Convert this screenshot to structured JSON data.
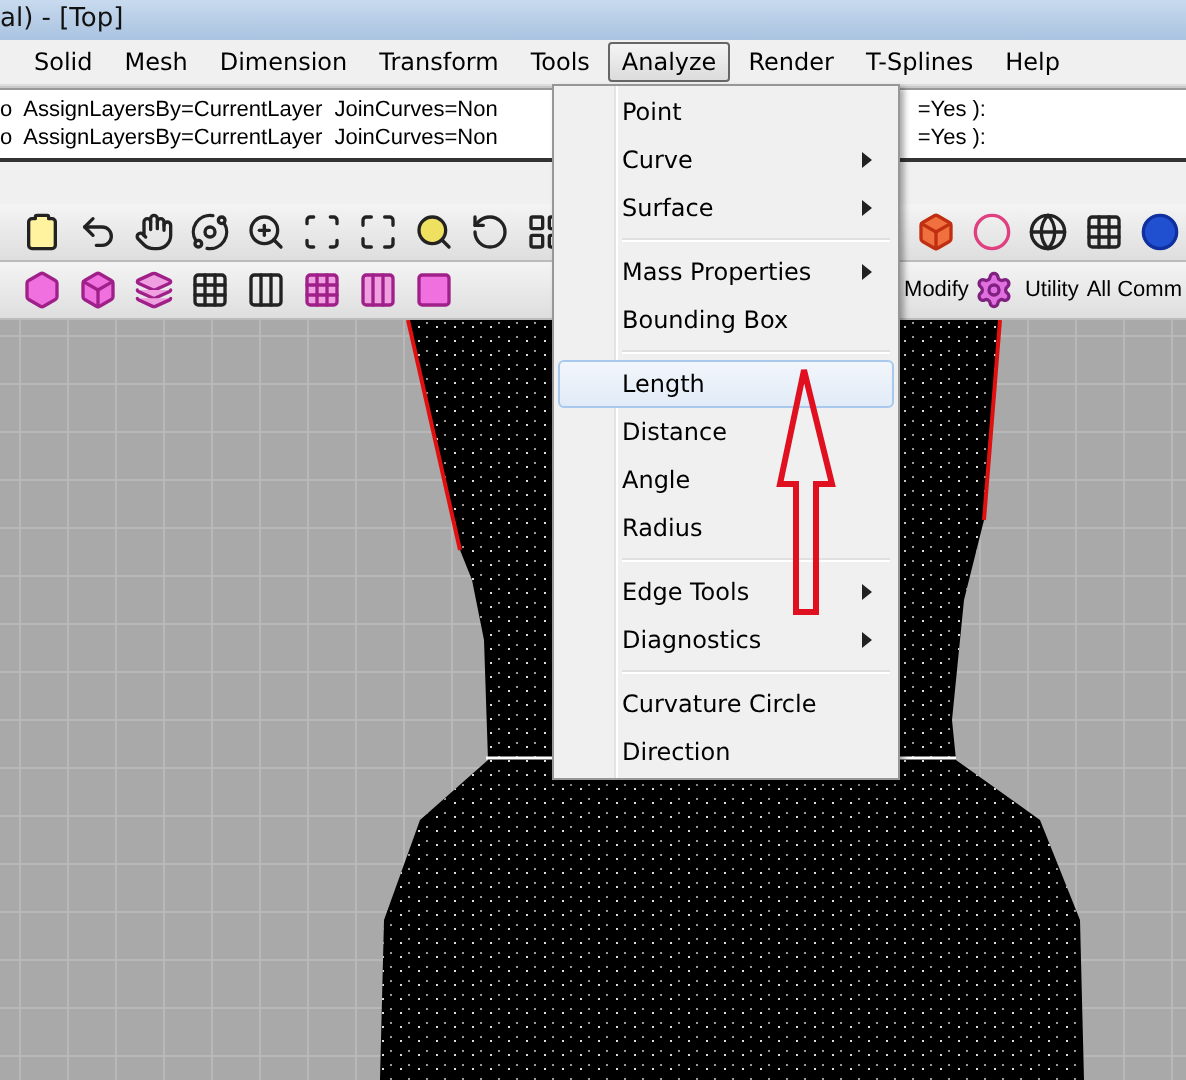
{
  "window": {
    "title": "al) - [Top]"
  },
  "menubar": [
    {
      "label": "Solid",
      "selected": false
    },
    {
      "label": "Mesh",
      "selected": false
    },
    {
      "label": "Dimension",
      "selected": false
    },
    {
      "label": "Transform",
      "selected": false
    },
    {
      "label": "Tools",
      "selected": false
    },
    {
      "label": "Analyze",
      "selected": true
    },
    {
      "label": "Render",
      "selected": false
    },
    {
      "label": "T-Splines",
      "selected": false
    },
    {
      "label": "Help",
      "selected": false
    }
  ],
  "command_history": [
    {
      "left": "o  AssignLayersBy=CurrentLayer  JoinCurves=Non",
      "right": "=Yes ):"
    },
    {
      "left": "o  AssignLayersBy=CurrentLayer  JoinCurves=Non",
      "right": "=Yes ):"
    }
  ],
  "toolbar_tabs": [
    "Modify",
    "Utility",
    "All Comm"
  ],
  "menu": {
    "sections": [
      [
        {
          "label": "Point",
          "submenu": false,
          "selected": false
        },
        {
          "label": "Curve",
          "submenu": true,
          "selected": false
        },
        {
          "label": "Surface",
          "submenu": true,
          "selected": false
        }
      ],
      [
        {
          "label": "Mass Properties",
          "submenu": true,
          "selected": false
        },
        {
          "label": "Bounding Box",
          "submenu": false,
          "selected": false
        }
      ],
      [
        {
          "label": "Length",
          "submenu": false,
          "selected": true
        },
        {
          "label": "Distance",
          "submenu": false,
          "selected": false
        },
        {
          "label": "Angle",
          "submenu": false,
          "selected": false
        },
        {
          "label": "Radius",
          "submenu": false,
          "selected": false
        }
      ],
      [
        {
          "label": "Edge Tools",
          "submenu": true,
          "selected": false
        },
        {
          "label": "Diagnostics",
          "submenu": true,
          "selected": false
        }
      ],
      [
        {
          "label": "Curvature Circle",
          "submenu": false,
          "selected": false
        },
        {
          "label": "Direction",
          "submenu": false,
          "selected": false
        }
      ]
    ]
  }
}
